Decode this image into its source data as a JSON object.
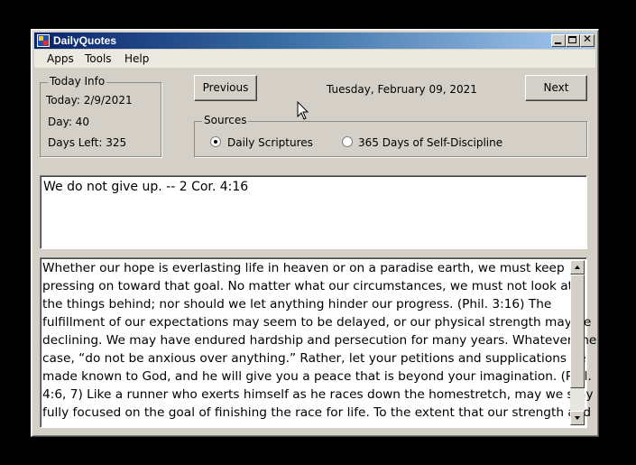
{
  "window": {
    "title": "DailyQuotes",
    "close_glyph": "✕"
  },
  "menu": {
    "items": [
      "Apps",
      "Tools",
      "Help"
    ]
  },
  "today_info": {
    "title": "Today Info",
    "today": "Today: 2/9/2021",
    "day": "Day: 40",
    "days_left": "Days Left: 325"
  },
  "nav": {
    "previous_label": "Previous",
    "next_label": "Next",
    "date": "Tuesday, February 09, 2021"
  },
  "sources": {
    "title": "Sources",
    "options": [
      {
        "label": "Daily Scriptures",
        "selected": true
      },
      {
        "label": "365 Days of Self-Discipline",
        "selected": false
      }
    ]
  },
  "quote": {
    "text": "We do not give up. -- 2 Cor. 4:16"
  },
  "body": {
    "lines": [
      "Whether our hope is everlasting life in heaven or on a paradise earth, we must keep",
      "pressing on toward that goal. No matter what our circumstances, we must not look at",
      "the things behind; nor should we let anything hinder our progress. (Phil. 3:16) The",
      "fulfillment of our expectations may seem to be delayed, or our physical strength may be",
      "declining. We may have endured hardship and persecution for many years. Whatever the",
      "case, “do not be anxious over anything.” Rather, let your petitions and supplications be",
      "made known to God, and he will give you a peace that is beyond your imagination. (Phil.",
      "4:6, 7) Like a runner who exerts himself as he races down the homestretch, may we stay",
      "fully focused on the goal of finishing the race for life. To the extent that our strength and"
    ]
  }
}
